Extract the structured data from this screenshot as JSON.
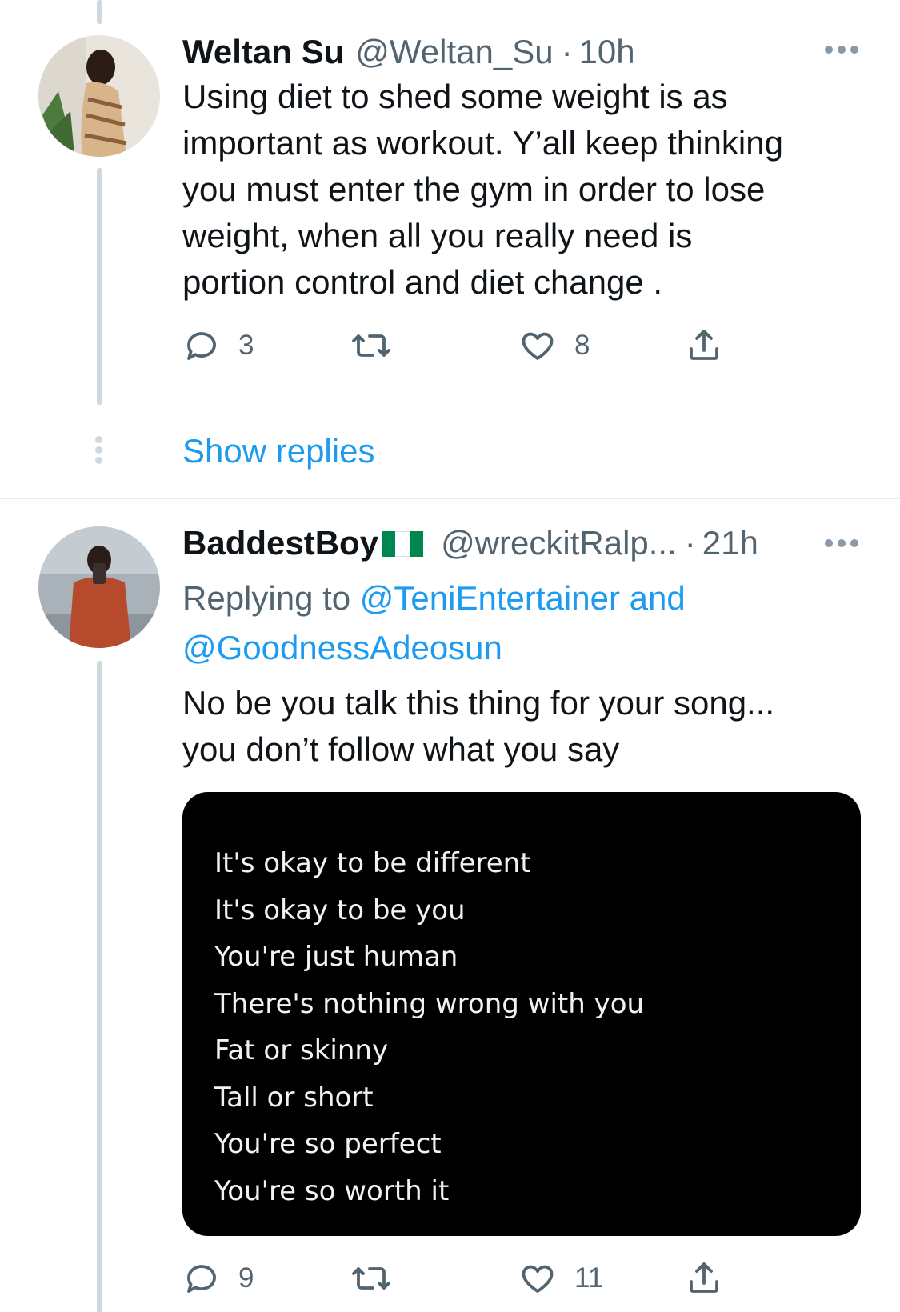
{
  "tweet1": {
    "name": "Weltan Su",
    "handle": "@Weltan_Su",
    "separator": "·",
    "time": "10h",
    "text_lines": [
      "Using diet to shed some weight is as",
      "important as workout. Y’all keep thinking",
      "you must enter the gym in order to lose",
      "weight, when all you really need is",
      "portion control and diet change ."
    ],
    "replies": "3",
    "likes": "8",
    "icons": [
      "reply-icon",
      "retweet-icon",
      "like-icon",
      "share-icon",
      "more-icon"
    ]
  },
  "show_replies": "Show replies",
  "tweet2": {
    "name": "BaddestBoy",
    "flag_colors": [
      "#008751",
      "#ffffff",
      "#008751"
    ],
    "handle": "@wreckitRalp...",
    "separator": "·",
    "time": "21h",
    "replying_prefix": "Replying to",
    "mention_1": "@TeniEntertainer",
    "mention_joiner": "and",
    "mention_2": "@GoodnessAdeosun",
    "text_lines": [
      "No be you talk this thing for your song...",
      "you don’t follow what you say"
    ],
    "media_lines": [
      "It's okay to be different",
      "It's okay to be you",
      "You're just human",
      "There's nothing wrong with you",
      "Fat or skinny",
      "Tall or short",
      "You're so perfect",
      "You're so worth it"
    ],
    "replies": "9",
    "likes": "11"
  },
  "colors": {
    "link": "#1d9bf0",
    "secondary_text": "#536471",
    "thread_line": "#cfd9de"
  }
}
